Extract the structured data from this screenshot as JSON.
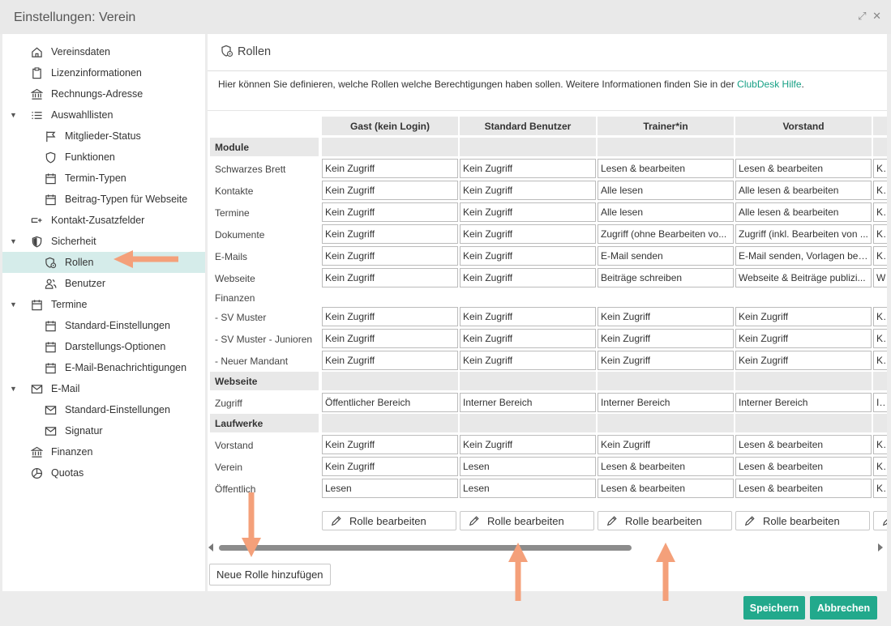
{
  "window": {
    "title": "Einstellungen: Verein",
    "expand_icon": "expand-icon",
    "close_icon": "close-icon"
  },
  "sidebar": {
    "items": [
      {
        "label": "Vereinsdaten",
        "icon": "home-icon",
        "level": 1,
        "caret": false,
        "active": false
      },
      {
        "label": "Lizenzinformationen",
        "icon": "clipboard-icon",
        "level": 1,
        "caret": false,
        "active": false
      },
      {
        "label": "Rechnungs-Adresse",
        "icon": "bank-icon",
        "level": 1,
        "caret": false,
        "active": false
      },
      {
        "label": "Auswahllisten",
        "icon": "list-icon",
        "level": 1,
        "caret": true,
        "active": false
      },
      {
        "label": "Mitglieder-Status",
        "icon": "flag-icon",
        "level": 2,
        "caret": false,
        "active": false
      },
      {
        "label": "Funktionen",
        "icon": "shield-icon",
        "level": 2,
        "caret": false,
        "active": false
      },
      {
        "label": "Termin-Typen",
        "icon": "calendar-icon",
        "level": 2,
        "caret": false,
        "active": false
      },
      {
        "label": "Beitrag-Typen für Webseite",
        "icon": "calendar-icon",
        "level": 2,
        "caret": false,
        "active": false
      },
      {
        "label": "Kontakt-Zusatzfelder",
        "icon": "field-add-icon",
        "level": 1,
        "caret": false,
        "active": false
      },
      {
        "label": "Sicherheit",
        "icon": "shield-filled-icon",
        "level": 1,
        "caret": true,
        "active": false
      },
      {
        "label": "Rollen",
        "icon": "role-icon",
        "level": 2,
        "caret": false,
        "active": true
      },
      {
        "label": "Benutzer",
        "icon": "users-icon",
        "level": 2,
        "caret": false,
        "active": false
      },
      {
        "label": "Termine",
        "icon": "calendar-icon",
        "level": 1,
        "caret": true,
        "active": false
      },
      {
        "label": "Standard-Einstellungen",
        "icon": "calendar-icon",
        "level": 2,
        "caret": false,
        "active": false
      },
      {
        "label": "Darstellungs-Optionen",
        "icon": "calendar-icon",
        "level": 2,
        "caret": false,
        "active": false
      },
      {
        "label": "E-Mail-Benachrichtigungen",
        "icon": "calendar-icon",
        "level": 2,
        "caret": false,
        "active": false
      },
      {
        "label": "E-Mail",
        "icon": "mail-icon",
        "level": 1,
        "caret": true,
        "active": false
      },
      {
        "label": "Standard-Einstellungen",
        "icon": "mail-icon",
        "level": 2,
        "caret": false,
        "active": false
      },
      {
        "label": "Signatur",
        "icon": "mail-icon",
        "level": 2,
        "caret": false,
        "active": false
      },
      {
        "label": "Finanzen",
        "icon": "bank-icon",
        "level": 1,
        "caret": false,
        "active": false
      },
      {
        "label": "Quotas",
        "icon": "pie-icon",
        "level": 1,
        "caret": false,
        "active": false
      }
    ]
  },
  "main": {
    "title": "Rollen",
    "intro_text": "Hier können Sie definieren, welche Rollen welche Berechtigungen haben sollen. Weitere Informationen finden Sie in der ",
    "intro_link": "ClubDesk Hilfe",
    "intro_end": ".",
    "columns": [
      "Gast (kein Login)",
      "Standard Benutzer",
      "Trainer*in",
      "Vorstand",
      ""
    ],
    "rows": [
      {
        "type": "section",
        "label": "Module"
      },
      {
        "type": "row",
        "label": "Schwarzes Brett",
        "values": [
          "Kein Zugriff",
          "Kein Zugriff",
          "Lesen & bearbeiten",
          "Lesen & bearbeiten",
          "Ke"
        ]
      },
      {
        "type": "row",
        "label": "Kontakte",
        "values": [
          "Kein Zugriff",
          "Kein Zugriff",
          "Alle lesen",
          "Alle lesen & bearbeiten",
          "Ke"
        ]
      },
      {
        "type": "row",
        "label": "Termine",
        "values": [
          "Kein Zugriff",
          "Kein Zugriff",
          "Alle lesen",
          "Alle lesen & bearbeiten",
          "Ke"
        ]
      },
      {
        "type": "row",
        "label": "Dokumente",
        "values": [
          "Kein Zugriff",
          "Kein Zugriff",
          "Zugriff (ohne Bearbeiten vo...",
          "Zugriff (inkl. Bearbeiten von ...",
          "Ke"
        ]
      },
      {
        "type": "row",
        "label": "E-Mails",
        "values": [
          "Kein Zugriff",
          "Kein Zugriff",
          "E-Mail senden",
          "E-Mail senden, Vorlagen bea...",
          "Ke"
        ]
      },
      {
        "type": "row",
        "label": "Webseite",
        "values": [
          "Kein Zugriff",
          "Kein Zugriff",
          "Beiträge schreiben",
          "Webseite & Beiträge publizi...",
          "We"
        ]
      },
      {
        "type": "label",
        "label": "Finanzen"
      },
      {
        "type": "row",
        "label": "- SV Muster",
        "values": [
          "Kein Zugriff",
          "Kein Zugriff",
          "Kein Zugriff",
          "Kein Zugriff",
          "Ke"
        ]
      },
      {
        "type": "row",
        "label": "- SV Muster - Junioren",
        "values": [
          "Kein Zugriff",
          "Kein Zugriff",
          "Kein Zugriff",
          "Kein Zugriff",
          "Ke"
        ]
      },
      {
        "type": "row",
        "label": "- Neuer Mandant",
        "values": [
          "Kein Zugriff",
          "Kein Zugriff",
          "Kein Zugriff",
          "Kein Zugriff",
          "Ke"
        ]
      },
      {
        "type": "section",
        "label": "Webseite"
      },
      {
        "type": "row",
        "label": "Zugriff",
        "values": [
          "Öffentlicher Bereich",
          "Interner Bereich",
          "Interner Bereich",
          "Interner Bereich",
          "Int"
        ]
      },
      {
        "type": "section",
        "label": "Laufwerke"
      },
      {
        "type": "row",
        "label": "Vorstand",
        "values": [
          "Kein Zugriff",
          "Kein Zugriff",
          "Kein Zugriff",
          "Lesen & bearbeiten",
          "Ke"
        ]
      },
      {
        "type": "row",
        "label": "Verein",
        "values": [
          "Kein Zugriff",
          "Lesen",
          "Lesen & bearbeiten",
          "Lesen & bearbeiten",
          "Ke"
        ]
      },
      {
        "type": "row",
        "label": "Öffentlich",
        "values": [
          "Lesen",
          "Lesen",
          "Lesen & bearbeiten",
          "Lesen & bearbeiten",
          "Ke"
        ]
      }
    ],
    "edit_button_label": "Rolle bearbeiten",
    "add_role_button": "Neue Rolle hinzufügen"
  },
  "footer": {
    "save": "Speichern",
    "cancel": "Abbrechen"
  },
  "colors": {
    "accent": "#22a98c",
    "link": "#16a085",
    "active_bg": "#d5ecea",
    "annotation_arrow": "#f4a07a"
  }
}
